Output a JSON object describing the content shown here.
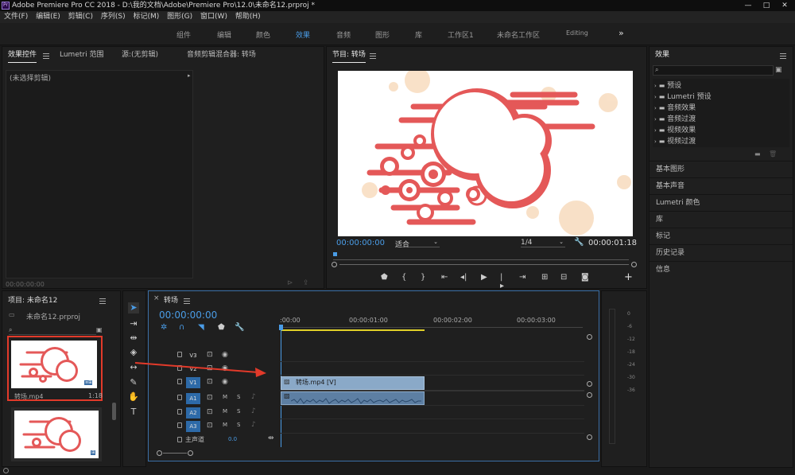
{
  "titlebar": {
    "app_icon": "Pr",
    "title": "Adobe Premiere Pro CC 2018 - D:\\我的文档\\Adobe\\Premiere Pro\\12.0\\未命名12.prproj *",
    "controls": [
      "—",
      "□",
      "✕"
    ]
  },
  "menubar": {
    "items": [
      "文件(F)",
      "编辑(E)",
      "剪辑(C)",
      "序列(S)",
      "标记(M)",
      "图形(G)",
      "窗口(W)",
      "帮助(H)"
    ]
  },
  "workspaces": {
    "items": [
      "组件",
      "编辑",
      "颜色",
      "效果",
      "音频",
      "图形",
      "库",
      "工作区1",
      "未命名工作区",
      "Editing"
    ],
    "active": "效果",
    "more": "»"
  },
  "source_panel": {
    "tabs": [
      "效果控件",
      "Lumetri 范围",
      "源:(无剪辑)",
      "音频剪辑混合器: 转场"
    ],
    "no_clip": "(未选择剪辑)",
    "timecode": "00:00:00:00"
  },
  "program_panel": {
    "title": "节目: 转场",
    "timecode_in": "00:00:00:00",
    "fit": "适合",
    "quality": "1/4",
    "timecode_out": "00:00:01:18"
  },
  "effects_panel": {
    "title": "效果",
    "search_placeholder": "",
    "tree": [
      "预设",
      "Lumetri 预设",
      "音频效果",
      "音频过渡",
      "视频效果",
      "视频过渡"
    ],
    "sections": [
      "基本图形",
      "基本声音",
      "Lumetri 颜色",
      "库",
      "标记",
      "历史记录",
      "信息"
    ]
  },
  "project_panel": {
    "title": "项目: 未命名12",
    "file": "未命名12.prproj",
    "clip1_name": "转场.mp4",
    "clip1_dur": "1:18",
    "clip1_badge": "≡⊞",
    "clip2_badge": "⊞"
  },
  "timeline": {
    "title": "转场",
    "close": "×",
    "timecode": "00:00:00:00",
    "ruler": [
      ":00:00",
      "00:00:01:00",
      "00:00:02:00",
      "00:00:03:00"
    ],
    "tracks": [
      {
        "name": "V3",
        "type": "video"
      },
      {
        "name": "V2",
        "type": "video"
      },
      {
        "name": "V1",
        "type": "video"
      },
      {
        "name": "A1",
        "type": "audio"
      },
      {
        "name": "A2",
        "type": "audio"
      },
      {
        "name": "A3",
        "type": "audio"
      }
    ],
    "master": "主声道",
    "master_val": "0.0",
    "clip_v1": "转场.mp4 [V]",
    "m": "M",
    "s": "S"
  },
  "meter": {
    "scale": [
      "0",
      "-6",
      "-12",
      "-18",
      "-24",
      "-30",
      "-36"
    ]
  },
  "colors": {
    "accent": "#4a9ce6",
    "graphic_red": "#e45858",
    "annotation_red": "#e23a2a"
  }
}
